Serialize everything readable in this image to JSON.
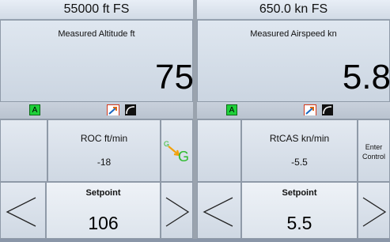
{
  "left": {
    "header": "55000 ft FS",
    "measure_title": "Measured Altitude ft",
    "measure_value": "75",
    "status_a": "A",
    "rate_label": "ROC ft/min",
    "rate_value": "-18",
    "g_icon_small": "G",
    "g_icon_big": "G",
    "setpoint_label": "Setpoint",
    "setpoint_value": "106",
    "arrow_left": "<",
    "arrow_right": ">"
  },
  "right": {
    "header": "650.0 kn FS",
    "measure_title": "Measured Airspeed kn",
    "measure_value": "5.8",
    "status_a": "A",
    "rate_label": "RtCAS kn/min",
    "rate_value": "-5.5",
    "enter_label_1": "Enter",
    "enter_label_2": "Control",
    "setpoint_label": "Setpoint",
    "setpoint_value": "5.5",
    "arrow_left": "<",
    "arrow_right": ">"
  },
  "colors": {
    "indicator_green": "#1fd03a",
    "g_icon_green": "#2dbb2d",
    "g_arrow_orange": "#f2a20c"
  }
}
